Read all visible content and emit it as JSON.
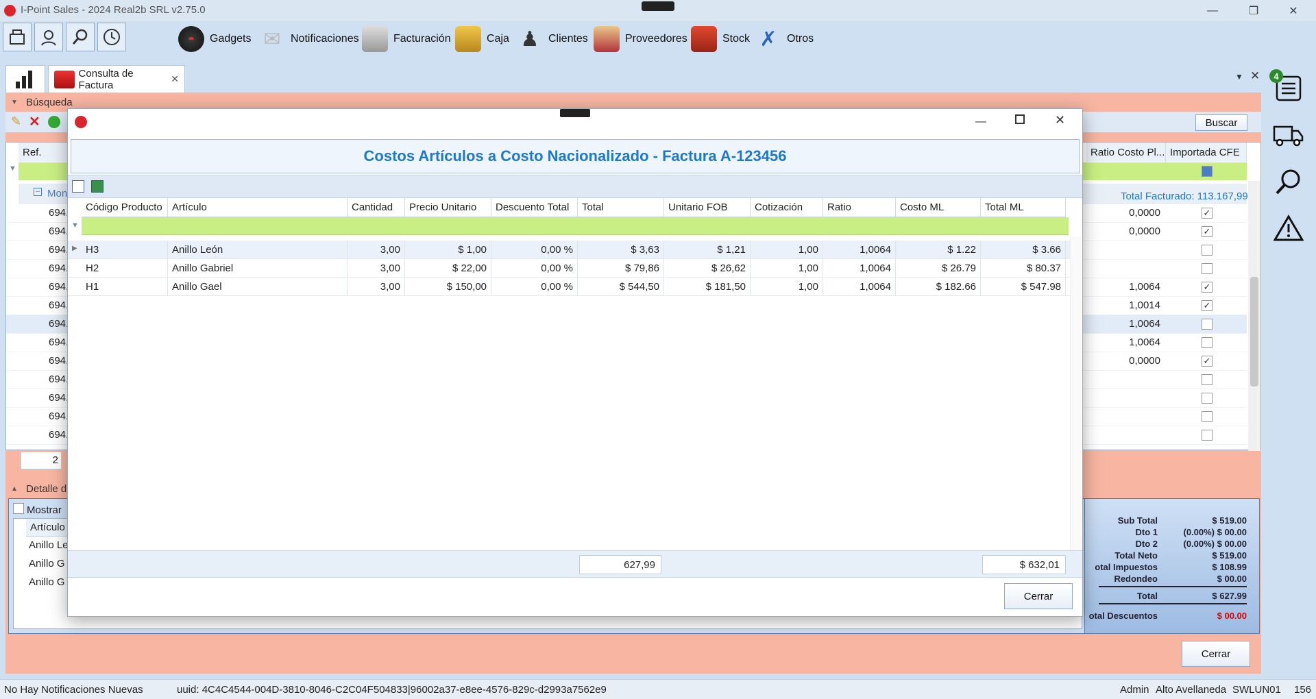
{
  "app": {
    "title": "I-Point Sales  - 2024 Real2b SRL v2.75.0"
  },
  "menu": {
    "items": [
      {
        "label": "Gadgets",
        "icon": "gauge-icon"
      },
      {
        "label": "Notificaciones",
        "icon": "envelope-icon"
      },
      {
        "label": "Facturación",
        "icon": "cash-register-icon"
      },
      {
        "label": "Caja",
        "icon": "safe-icon"
      },
      {
        "label": "Clientes",
        "icon": "person-icon"
      },
      {
        "label": "Proveedores",
        "icon": "supplier-icon"
      },
      {
        "label": "Stock",
        "icon": "boxes-icon"
      },
      {
        "label": "Otros",
        "icon": "tools-icon"
      }
    ]
  },
  "tabs": {
    "active_label": "Consulta de Factura"
  },
  "rightbar": {
    "badge": "4"
  },
  "background": {
    "busqueda_label": "Búsqueda",
    "buscar_button": "Buscar",
    "col_ref": "Ref.",
    "col_ratio": "Ratio Costo Pl...",
    "col_importada": "Importada CFE",
    "group_label": "Mon",
    "total_facturado": "Total Facturado: 113.167,99",
    "rows": [
      {
        "ref": "694.",
        "ratio": "0,0000",
        "checked": true
      },
      {
        "ref": "694.",
        "ratio": "0,0000",
        "checked": true
      },
      {
        "ref": "694.",
        "ratio": "",
        "checked": false
      },
      {
        "ref": "694.",
        "ratio": "",
        "checked": false
      },
      {
        "ref": "694.",
        "ratio": "1,0064",
        "checked": true
      },
      {
        "ref": "694.",
        "ratio": "1,0014",
        "checked": true
      },
      {
        "ref": "694.",
        "ratio": "1,0064",
        "checked": false
      },
      {
        "ref": "694.",
        "ratio": "1,0064",
        "checked": false
      },
      {
        "ref": "694.",
        "ratio": "0,0000",
        "checked": true
      },
      {
        "ref": "694.",
        "ratio": "",
        "checked": false
      },
      {
        "ref": "694.",
        "ratio": "",
        "checked": false
      },
      {
        "ref": "694.",
        "ratio": "",
        "checked": false
      },
      {
        "ref": "694.",
        "ratio": "",
        "checked": false
      }
    ],
    "pager_value": "2",
    "detalle_label": "Detalle d",
    "mostrar_label": "Mostrar",
    "articulo_header": "Artículo",
    "articulo_rows": [
      "Anillo Le",
      "Anillo G",
      "Anillo G"
    ],
    "cerrar_button": "Cerrar",
    "summary": [
      {
        "label": "Sub Total",
        "value": "$ 519.00"
      },
      {
        "label": "Dto 1",
        "value": "(0.00%) $ 00.00"
      },
      {
        "label": "Dto 2",
        "value": "(0.00%) $ 00.00"
      },
      {
        "label": "Total Neto",
        "value": "$ 519.00"
      },
      {
        "label": "otal Impuestos",
        "value": "$ 108.99"
      },
      {
        "label": "Redondeo",
        "value": "$ 00.00"
      },
      {
        "label": "Total",
        "value": "$ 627.99"
      },
      {
        "label": "otal Descuentos",
        "value": "$ 00.00"
      }
    ]
  },
  "modal": {
    "title": "Costos Artículos a Costo Nacionalizado - Factura A-123456",
    "columns": [
      "Código Producto",
      "Artículo",
      "Cantidad",
      "Precio Unitario",
      "Descuento Total",
      "Total",
      "Unitario FOB",
      "Cotización",
      "Ratio",
      "Costo ML",
      "Total ML"
    ],
    "rows": [
      [
        "H3",
        "Anillo León",
        "3,00",
        "$ 1,00",
        "0,00 %",
        "$ 3,63",
        "$ 1,21",
        "1,00",
        "1,0064",
        "$ 1.22",
        "$ 3.66"
      ],
      [
        "H2",
        "Anillo Gabriel",
        "3,00",
        "$ 22,00",
        "0,00 %",
        "$ 79,86",
        "$ 26,62",
        "1,00",
        "1,0064",
        "$ 26.79",
        "$ 80.37"
      ],
      [
        "H1",
        "Anillo Gael",
        "3,00",
        "$ 150,00",
        "0,00 %",
        "$ 544,50",
        "$ 181,50",
        "1,00",
        "1,0064",
        "$ 182.66",
        "$ 547.98"
      ]
    ],
    "footer_total": "627,99",
    "footer_total_ml": "$ 632,01",
    "cerrar_button": "Cerrar"
  },
  "status": {
    "notifications": "No Hay Notificaciones Nuevas",
    "uuid": "uuid: 4C4C4544-004D-3810-8046-C2C04F504833|96002a37-e8ee-4576-829c-d2993a7562e9",
    "user": "Admin",
    "branch": "Alto Avellaneda",
    "machine": "SWLUN01",
    "number": "156"
  },
  "colors": {
    "accent_blue": "#1f78c8",
    "filter_green": "#c9ef84",
    "salmon": "#f7b5a2",
    "red_value": "#e00000"
  }
}
